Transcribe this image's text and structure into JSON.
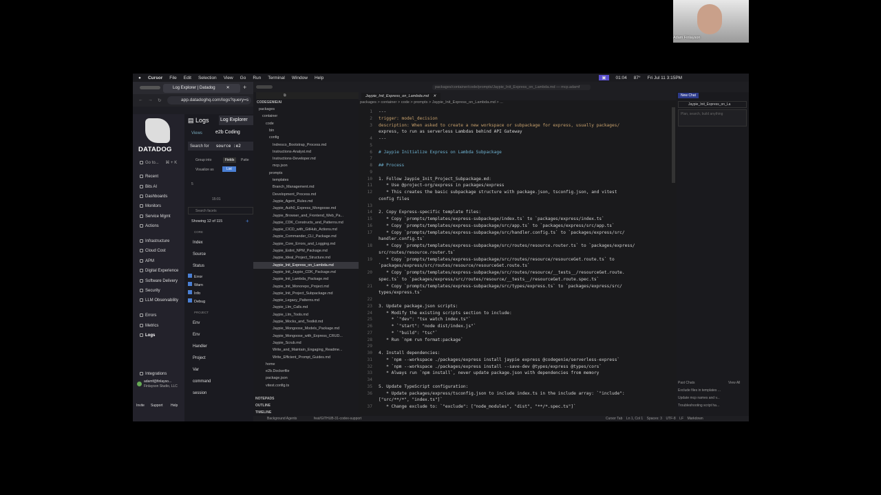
{
  "webcam": {
    "name": "Adam Finlayson"
  },
  "menubar": {
    "app": "Cursor",
    "items": [
      "File",
      "Edit",
      "Selection",
      "View",
      "Go",
      "Run",
      "Terminal",
      "Window",
      "Help"
    ],
    "time_left": "01:04",
    "battery": "87°",
    "clock": "Fri Jul 11  3:15PM"
  },
  "datadog": {
    "tab_title": "Log Explorer | Datadog",
    "url": "app.datadoghq.com/logs?query=s",
    "brand": "DATADOG",
    "goto": "Go to...",
    "goto_shortcut": "⌘ + K",
    "nav": [
      "Recent",
      "Bits AI",
      "Dashboards",
      "Monitors",
      "Service Mgmt",
      "Actions",
      "Infrastructure",
      "Cloud Cost",
      "APM",
      "Digital Experience",
      "Software Delivery",
      "Security",
      "LLM Observability",
      "Errors",
      "Metrics",
      "Logs",
      "Integrations"
    ],
    "user": {
      "email": "adamf@finlayso...",
      "org": "Finlayson Studio, LLC"
    },
    "footer": [
      "Invite",
      "Support",
      "Help"
    ],
    "logs_label": "Logs",
    "log_explorer": "Log Explorer",
    "views": "Views",
    "view_name": "e2b Coding",
    "search_for": "Search for",
    "search_value": "source :e2",
    "group_into": "Group into",
    "fields": "Fields",
    "patterns": "Patte",
    "visualize_as": "Visualize as",
    "list": "List",
    "chart_y": "5",
    "chart_x": "15:01",
    "search_facets": "Search facets",
    "showing": "Showing 12 of 115",
    "core": "CORE",
    "index": "Index",
    "source": "Source",
    "status": "Status",
    "statuses": [
      "Error",
      "Warn",
      "Info",
      "Debug"
    ],
    "project_header": "PROJECT",
    "facets": [
      "Env",
      "Env",
      "Handler",
      "Project",
      "Var",
      "command",
      "session"
    ]
  },
  "explorer": {
    "root": "CODEGENIE/AI",
    "rows": [
      "packages",
      "container",
      "code",
      "bin",
      "config",
      "Indresco_Bootstrap_Process.md",
      "Instructions-Analyst.md",
      "Instructions-Developer.md",
      "mcp.json",
      "prompts",
      "templates",
      "Branch_Management.md",
      "Development_Process.md",
      "Jaypie_Agent_Rules.md",
      "Jaypie_Auth0_Express_Mongoose.md",
      "Jaypie_Browser_and_Frontend_Web_Pa...",
      "Jaypie_CDK_Constructs_and_Patterns.md",
      "Jaypie_CICD_with_GitHub_Actions.md",
      "Jaypie_Commander_CLI_Package.md",
      "Jaypie_Core_Errors_and_Logging.md",
      "Jaypie_Eslint_NPM_Package.md",
      "Jaypie_Ideal_Project_Structure.md",
      "Jaypie_Init_Express_on_Lambda.md",
      "Jaypie_Init_Jaypie_CDK_Package.md",
      "Jaypie_Init_Lambda_Package.md",
      "Jaypie_Init_Monorepo_Project.md",
      "Jaypie_Init_Project_Subpackage.md",
      "Jaypie_Legacy_Patterns.md",
      "Jaypie_Llm_Calls.md",
      "Jaypie_Llm_Tools.md",
      "Jaypie_Mocks_and_Testkit.md",
      "Jaypie_Mongoose_Models_Package.md",
      "Jaypie_Mongoose_with_Express_CRUD...",
      "Jaypie_Scrub.md",
      "Write_and_Maintain_Engaging_Readme...",
      "Write_Efficient_Prompt_Guides.md",
      "home",
      "e2b.Dockerfile",
      "package.json",
      "vitest.config.ts"
    ],
    "sections": [
      "NOTEPADS",
      "OUTLINE",
      "TIMELINE"
    ]
  },
  "code": {
    "tab": "Jaypie_Init_Express_on_Lambda.md",
    "title_path": "packages/container/code/prompts/Jaypie_Init_Express_on_Lambda.md — mcp.adamf",
    "breadcrumb": "packages > container > code > prompts > Jaypie_Init_Express_on_Lambda.md > ...",
    "lines": [
      {
        "n": "1",
        "t": "---"
      },
      {
        "n": "2",
        "t": "trigger: model_decision"
      },
      {
        "n": "3",
        "t": "description: When asked to create a new workspace or subpackage for express, usually packages/"
      },
      {
        "n": "",
        "t": "express, to run as serverless Lambdas behind API Gateway"
      },
      {
        "n": "4",
        "t": "---"
      },
      {
        "n": "5",
        "t": ""
      },
      {
        "n": "6",
        "t": "# Jaypie Initialize Express on Lambda Subpackage"
      },
      {
        "n": "7",
        "t": ""
      },
      {
        "n": "8",
        "t": "## Process"
      },
      {
        "n": "9",
        "t": ""
      },
      {
        "n": "10",
        "t": "1. Follow Jaypie_Init_Project_Subpackage.md:"
      },
      {
        "n": "11",
        "t": "   * Use @project-org/express in packages/express"
      },
      {
        "n": "12",
        "t": "   * This creates the basic subpackage structure with package.json, tsconfig.json, and vitest"
      },
      {
        "n": "",
        "t": "config files"
      },
      {
        "n": "13",
        "t": ""
      },
      {
        "n": "14",
        "t": "2. Copy Express-specific template files:"
      },
      {
        "n": "15",
        "t": "   * Copy `prompts/templates/express-subpackage/index.ts` to `packages/express/index.ts`"
      },
      {
        "n": "16",
        "t": "   * Copy `prompts/templates/express-subpackage/src/app.ts` to `packages/express/src/app.ts`"
      },
      {
        "n": "17",
        "t": "   * Copy `prompts/templates/express-subpackage/src/handler.config.ts` to `packages/express/src/"
      },
      {
        "n": "",
        "t": "handler.config.ts`"
      },
      {
        "n": "18",
        "t": "   * Copy `prompts/templates/express-subpackage/src/routes/resource.router.ts` to `packages/express/"
      },
      {
        "n": "",
        "t": "src/routes/resource.router.ts`"
      },
      {
        "n": "19",
        "t": "   * Copy `prompts/templates/express-subpackage/src/routes/resource/resourceGet.route.ts` to"
      },
      {
        "n": "",
        "t": "`packages/express/src/routes/resource/resourceGet.route.ts`"
      },
      {
        "n": "20",
        "t": "   * Copy `prompts/templates/express-subpackage/src/routes/resource/__tests__/resourceGet.route."
      },
      {
        "n": "",
        "t": "spec.ts` to `packages/express/src/routes/resource/__tests__/resourceGet.route.spec.ts`"
      },
      {
        "n": "21",
        "t": "   * Copy `prompts/templates/express-subpackage/src/types/express.ts` to `packages/express/src/"
      },
      {
        "n": "",
        "t": "types/express.ts`"
      },
      {
        "n": "22",
        "t": ""
      },
      {
        "n": "23",
        "t": "3. Update package.json scripts:"
      },
      {
        "n": "24",
        "t": "   * Modify the existing scripts section to include:"
      },
      {
        "n": "25",
        "t": "     * `\"dev\": \"tsx watch index.ts\"`"
      },
      {
        "n": "26",
        "t": "     * `\"start\": \"node dist/index.js\"`"
      },
      {
        "n": "27",
        "t": "     * `\"build\": \"tsc\"`"
      },
      {
        "n": "28",
        "t": "   * Run `npm run format:package`"
      },
      {
        "n": "29",
        "t": ""
      },
      {
        "n": "30",
        "t": "4. Install dependencies:"
      },
      {
        "n": "31",
        "t": "   * `npm --workspace ./packages/express install jaypie express @codegenie/serverless-express`"
      },
      {
        "n": "32",
        "t": "   * `npm --workspace ./packages/express install --save-dev @types/express @types/cors`"
      },
      {
        "n": "33",
        "t": "   * Always run `npm install`, never update package.json with dependencies from memory"
      },
      {
        "n": "34",
        "t": ""
      },
      {
        "n": "35",
        "t": "5. Update TypeScript configuration:"
      },
      {
        "n": "36",
        "t": "   * Update packages/express/tsconfig.json to include index.ts in the include array: `\"include\":"
      },
      {
        "n": "",
        "t": "[\"src/**/*\", \"index.ts\"]`"
      },
      {
        "n": "37",
        "t": "   * Change exclude to: `\"exclude\": [\"node_modules\", \"dist\", \"**/*.spec.ts\"]`"
      }
    ]
  },
  "chat": {
    "new_chat": "New Chat",
    "tab": "Jaypie_Init_Express_on_La",
    "placeholder": "Plan, search, build anything",
    "past_chats": "Past Chats",
    "view_all": "View All",
    "past": [
      "Exclude files in templates ...",
      "Update mcp names and v...",
      "Troubleshooting script ha..."
    ]
  },
  "status": {
    "left": "Background Agents",
    "branch": "feat/GITHUB-31-codex-support",
    "right": "Cursor Tab    Ln 1, Col 1    Spaces: 3    UTF-8    LF    Markdown"
  }
}
